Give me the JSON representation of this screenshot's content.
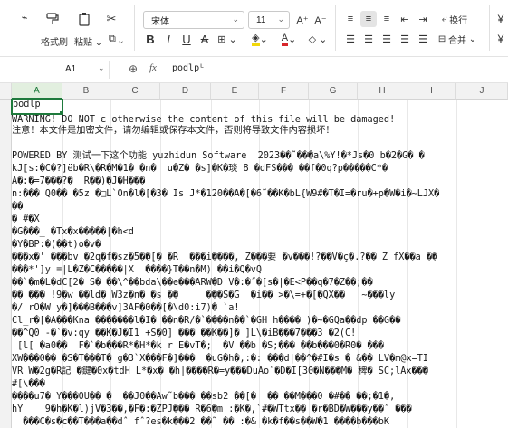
{
  "ribbon": {
    "format_brush": "格式刷",
    "paste": "粘贴",
    "font_name": "宋体",
    "font_size": "11",
    "wrap": "换行",
    "merge": "合并",
    "accent": "#1e7a3c"
  },
  "formula_bar": {
    "cell_ref": "A1",
    "fx": "fx",
    "value": "podlpᴸ"
  },
  "columns": [
    "A",
    "B",
    "C",
    "D",
    "E",
    "F",
    "G",
    "H",
    "I",
    "J"
  ],
  "selected_cell": "podlp",
  "lines": [
    "WARNING! DO NOT ɛ otherwise the content of this file will be damaged!",
    "注意！本文件是加密文件，请勿编辑或保存本文件，否则将导致文件内容损坏！",
    "",
    "POWERED BY 测试一下这个功能 yuzhidun Software  2023��˜���a\\%Y!�*Js�0 b�2�G� �",
    "kJ[s:�C�?]ëb�R\\�R�M�1� �n�  u�Z� �s]�K�琰 8 �dFS��� ��f�0q?p�����C*�",
    "A�:�=7���?�  R��)�J�H���",
    "n:��� Q0�� �5z �□L`On�l�[�3� Is J*�120��A�[�6˜��K�bL{W9#�T�I=�ru�+p�W�i�~LJX�",
    "��",
    "� #�X",
    "�G���_ �Tx�x�����|�h<d",
    "�Y�BP:�(��t)o�v�",
    "���x�' ���bv �2q�f�sz�5��[� �R  ���i����, Z���要 �v���!?��V�ç�.?�� Z fX��a ��",
    "���*']y ≡|L�Z�C�����|X  ����}T��n�M) ��i�Q�vQ",
    "��`�m�L�dC[2� S� ��\\^��bda\\��e���ARW�D V�:�˝�[s�|�E<P��q�7�Z��;��",
    "�� ��� !9�w ��ld� W3z�n� �s ��     ���S�G  �i�� >�\\=+�[�QX��   ~���ly",
    "�/ rO�W y�]���B���v]3AF�0��[�\\d0:i7)� `a!",
    "Cl_r�[�A���Kna �������l�I� ��n�R/�`����n��`�GH h���� )�~�GQa��dp ��G��",
    "��^Q0 -�`�v:qy ��K�J�I1 +S�0] ��� ��K��]� ]L\\�iB���7���3 �2(C!",
    " [l[ �a0��  F�`�b���R*�H*�k r E�vT�;  �V ��b �S;��� ��b���0�R0� ���",
    "XW���0�� �S�T���T� g�3`X���F�]���  �uG�h�,:�: ���d|��^�#I�s � &�� LV�m@x=TI",
    "VR W�2g�R記 �鍵�0x�tdH L*�x� �h|����R�=y���DuAo˝�D�I[30�N���M� 稗�_SC;lAx���",
    "#[\\���",
    "����u7� Y���0U�� �  ��J0��Aw˜b��� ��sb2 ��[�  �� ��M���0 �#�� ��;�1�, ",
    "hY    9�h�K�l)jV�3��,�F�:�ZPJ��� R�6�m :�K�,`#�WTtx��_�r�BD�W���y��˝ ���",
    "  ���C�s�c��T���a��dˆ fˆ?es�k���2 ��˜ �� :�& �k�f��s��W�1 ����b���bK"
  ]
}
